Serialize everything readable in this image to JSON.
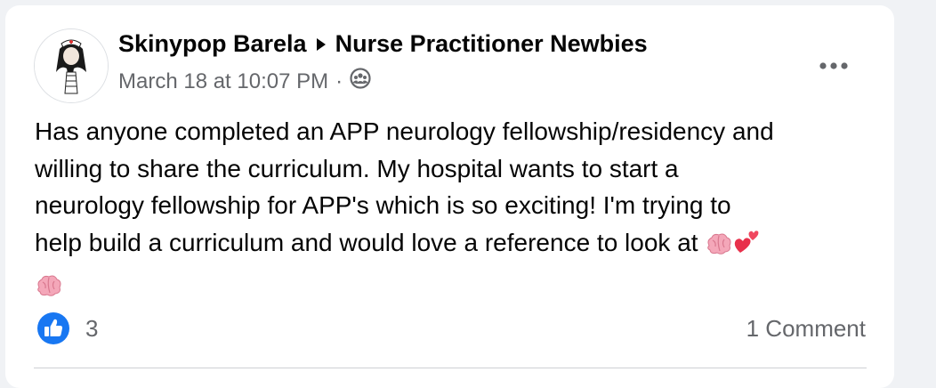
{
  "post": {
    "author": "Skinypop Barela",
    "group": "Nurse Practitioner Newbies",
    "timestamp": "March 18 at 10:07 PM",
    "separator": "·",
    "audience_icon": "group-audience-icon",
    "body_lines": [
      "Has anyone completed an APP neurology fellowship/residency and",
      "willing to share the curriculum. My hospital wants to start a",
      "neurology fellowship for APP's which is so exciting!  I'm trying to",
      "help build a curriculum and would love a reference to look at"
    ],
    "body_emojis": [
      "brain-emoji",
      "two-hearts-emoji",
      "brain-emoji"
    ],
    "like_count": "3",
    "comment_count": "1 Comment"
  },
  "colors": {
    "primary_text": "#050505",
    "secondary_text": "#65676b",
    "like_blue": "#1877f2",
    "brain_pink": "#f4a7b9",
    "heart_red": "#e8304b"
  }
}
